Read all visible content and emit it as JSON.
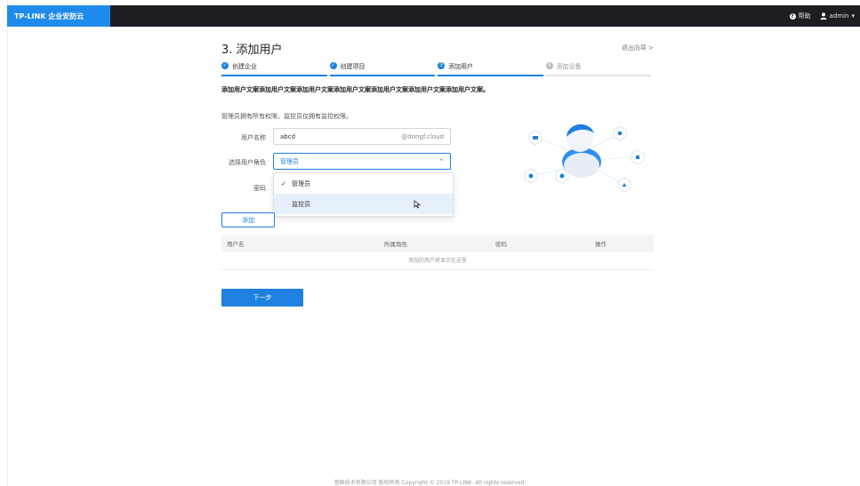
{
  "app": {
    "brand": "TP-LINK 企业安防云"
  },
  "topbar": {
    "help_label": "帮助",
    "user_label": "admin"
  },
  "page": {
    "title": "3. 添加用户",
    "exit_label": "退出向导 >"
  },
  "steps": [
    {
      "label": "创建企业",
      "state": "done"
    },
    {
      "label": "创建项目",
      "state": "done"
    },
    {
      "label": "添加用户",
      "state": "current",
      "number": "3"
    },
    {
      "label": "添加设备",
      "state": "todo",
      "number": "4"
    }
  ],
  "description": "添加用户文案添加用户文案添加用户文案添加用户文案添加用户文案添加用户文案添加用户文案。",
  "note": "管理员拥有所有权限，监控员仅拥有监控权限。",
  "form": {
    "username_label": "用户名称",
    "username_value": "abcd",
    "username_suffix": "@dongf.cloud",
    "role_label": "选择用户角色",
    "role_value": "管理员",
    "password_label": "密码",
    "role_options": [
      {
        "label": "管理员",
        "selected": true
      },
      {
        "label": "监控员",
        "selected": false
      }
    ]
  },
  "add_button": "添加",
  "table": {
    "columns": [
      "用户名",
      "所属角色",
      "密码",
      "操作"
    ],
    "empty_text": "添加的用户将显示在这里"
  },
  "next_button": "下一步",
  "footer": "普联技术有限公司 版权所有 Copyright © 2019 TP-LINK. All rights reserved.",
  "colors": {
    "primary": "#1e80e0",
    "topbar": "#1d1d24",
    "brand": "#1e8bec"
  }
}
